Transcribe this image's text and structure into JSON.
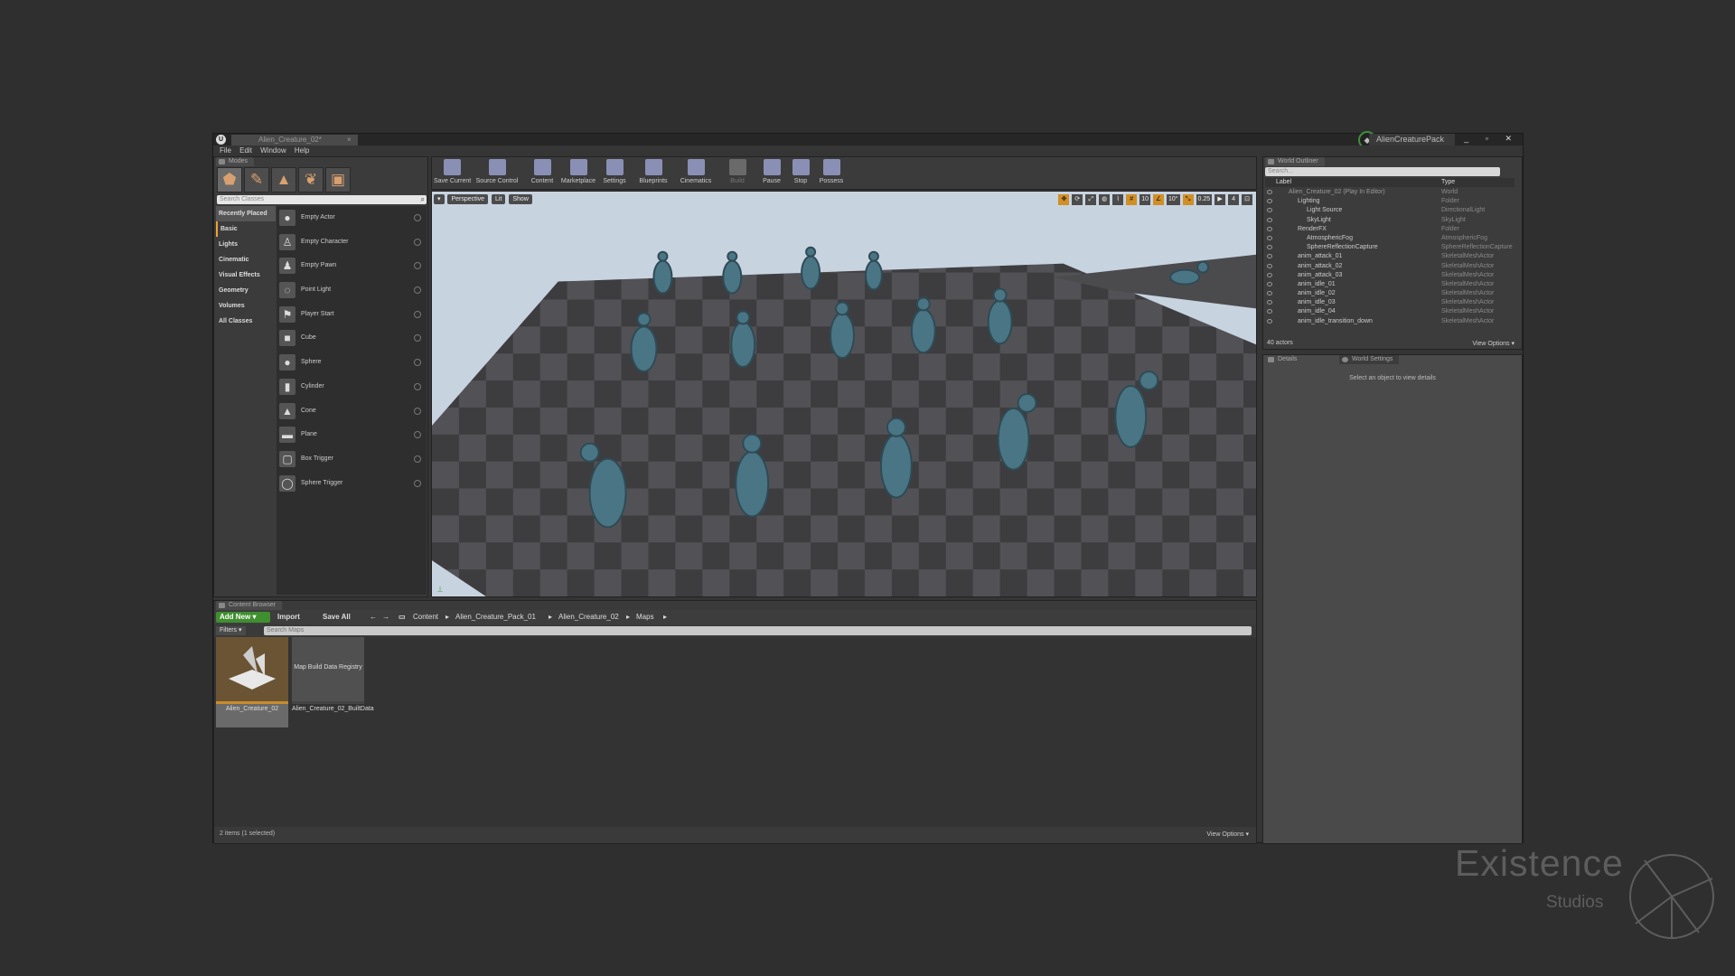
{
  "titlebar": {
    "logo": "U",
    "doc_tab": "Alien_Creature_02*",
    "doc_tab_close": "×",
    "project": "AlienCreaturePack",
    "window_controls": "_ ▫ ✕"
  },
  "menu": [
    "File",
    "Edit",
    "Window",
    "Help"
  ],
  "modes": {
    "tab": "Modes",
    "search_placeholder": "Search Classes",
    "categories": [
      "Recently Placed",
      "Basic",
      "Lights",
      "Cinematic",
      "Visual Effects",
      "Geometry",
      "Volumes",
      "All Classes"
    ],
    "items": [
      "Empty Actor",
      "Empty Character",
      "Empty Pawn",
      "Point Light",
      "Player Start",
      "Cube",
      "Sphere",
      "Cylinder",
      "Cone",
      "Plane",
      "Box Trigger",
      "Sphere Trigger"
    ]
  },
  "toolbar": {
    "buttons": [
      "Save Current",
      "Source Control",
      "Content",
      "Marketplace",
      "Settings",
      "Blueprints",
      "Cinematics",
      "Build",
      "Pause",
      "Stop",
      "Possess"
    ]
  },
  "viewport": {
    "perspective": "Perspective",
    "lit": "Lit",
    "show": "Show",
    "grid_snap": "10",
    "rot_snap": "10°",
    "scale_snap": "0.25",
    "cam_speed": "4",
    "colors": {
      "sky": "#c8d3e0",
      "floor_dark": "#3d3d40",
      "floor_light": "#525256",
      "creature": "#4a7585"
    }
  },
  "content_browser": {
    "tab": "Content Browser",
    "add_new": "Add New ▾",
    "import": "Import",
    "save_all": "Save All",
    "path": [
      "Content",
      "Alien_Creature_Pack_01",
      "Alien_Creature_02",
      "Maps"
    ],
    "filters": "Filters ▾",
    "search_placeholder": "Search Maps",
    "assets": [
      {
        "name": "Alien_Creature_02",
        "thumb_text": ""
      },
      {
        "name": "Alien_Creature_02_BuiltData",
        "thumb_text": "Map Build Data Registry"
      }
    ],
    "status": "2 items (1 selected)",
    "view_options": "View Options ▾"
  },
  "outliner": {
    "tab": "World Outliner",
    "search_placeholder": "Search...",
    "col_label": "Label",
    "col_type": "Type",
    "rows": [
      {
        "label": "Alien_Creature_02 (Play In Editor)",
        "type": "World"
      },
      {
        "label": "Lighting",
        "type": "Folder"
      },
      {
        "label": "Light Source",
        "type": "DirectionalLight"
      },
      {
        "label": "SkyLight",
        "type": "SkyLight"
      },
      {
        "label": "RenderFX",
        "type": "Folder"
      },
      {
        "label": "AtmosphericFog",
        "type": "AtmosphericFog"
      },
      {
        "label": "SphereReflectionCapture",
        "type": "SphereReflectionCapture"
      },
      {
        "label": "anim_attack_01",
        "type": "SkeletalMeshActor"
      },
      {
        "label": "anim_attack_02",
        "type": "SkeletalMeshActor"
      },
      {
        "label": "anim_attack_03",
        "type": "SkeletalMeshActor"
      },
      {
        "label": "anim_idle_01",
        "type": "SkeletalMeshActor"
      },
      {
        "label": "anim_idle_02",
        "type": "SkeletalMeshActor"
      },
      {
        "label": "anim_idle_03",
        "type": "SkeletalMeshActor"
      },
      {
        "label": "anim_idle_04",
        "type": "SkeletalMeshActor"
      },
      {
        "label": "anim_idle_transition_down",
        "type": "SkeletalMeshActor"
      }
    ],
    "status": "40 actors",
    "view_options": "View Options ▾"
  },
  "details": {
    "tab": "Details",
    "tab2": "World Settings",
    "message": "Select an object to view details"
  },
  "brand": {
    "name": "Existence",
    "sub": "Studios"
  }
}
